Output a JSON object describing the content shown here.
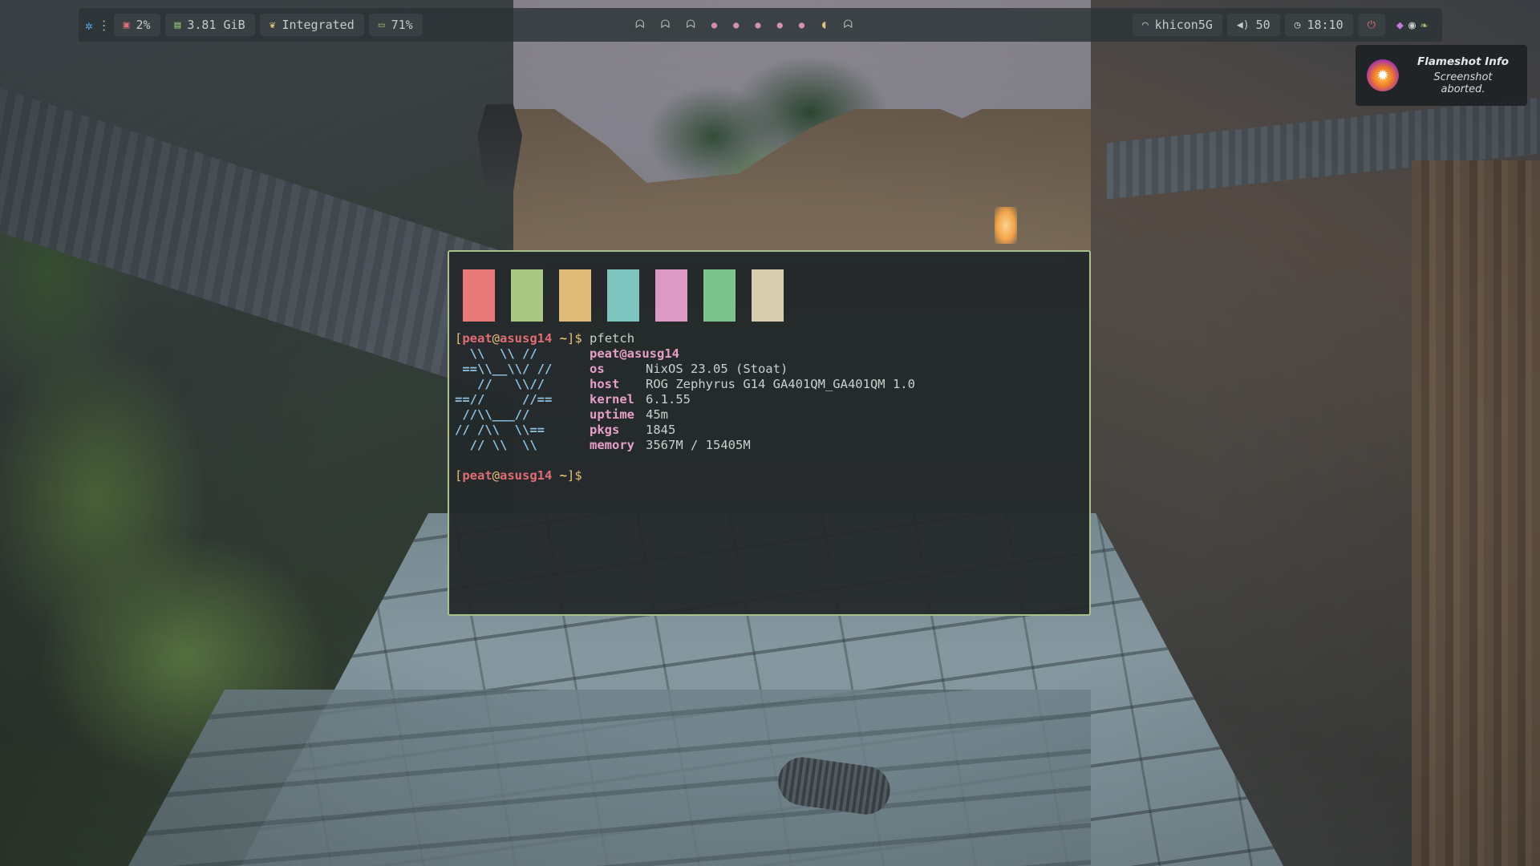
{
  "topbar": {
    "left": {
      "launcher_icon": "gear-icon",
      "menu_icon": "vertical-dots-icon",
      "cpu": {
        "icon": "cpu-chip-icon",
        "value": "2%"
      },
      "memory": {
        "icon": "ram-icon",
        "value": "3.81 GiB"
      },
      "gpu": {
        "icon": "leaf-icon",
        "value": "Integrated"
      },
      "battery": {
        "icon": "battery-icon",
        "value": "71%"
      }
    },
    "workspaces": [
      {
        "type": "ghost",
        "icon": "ghost-icon",
        "glyph": "ᗣ"
      },
      {
        "type": "ghost",
        "icon": "ghost-icon",
        "glyph": "ᗣ"
      },
      {
        "type": "ghost",
        "icon": "ghost-icon",
        "glyph": "ᗣ"
      },
      {
        "type": "dot",
        "icon": "dot-icon",
        "glyph": "●"
      },
      {
        "type": "dot",
        "icon": "dot-icon",
        "glyph": "●"
      },
      {
        "type": "dot",
        "icon": "dot-icon",
        "glyph": "●"
      },
      {
        "type": "dot",
        "icon": "dot-icon",
        "glyph": "●"
      },
      {
        "type": "dot",
        "icon": "dot-icon",
        "glyph": "●"
      },
      {
        "type": "pacman",
        "icon": "pacman-icon",
        "glyph": "◖"
      },
      {
        "type": "ghost",
        "icon": "ghost-icon",
        "glyph": "ᗣ"
      }
    ],
    "right": {
      "wifi": {
        "icon": "wifi-icon",
        "value": "khicon5G"
      },
      "volume": {
        "icon": "speaker-icon",
        "value": "50"
      },
      "clock": {
        "icon": "clock-icon",
        "value": "18:10"
      },
      "power_icon": "power-icon",
      "tray": [
        "flameshot-tray-icon",
        "discord-tray-icon",
        "leaf-tray-icon"
      ]
    }
  },
  "notification": {
    "icon": "flameshot-icon",
    "title": "Flameshot Info",
    "body": "Screenshot aborted."
  },
  "terminal": {
    "border_color": "#a7c08c",
    "swatch_colors": [
      "#e87a7a",
      "#a8c884",
      "#e0bb78",
      "#7ec4be",
      "#dc99c4",
      "#7dc48c",
      "#d8cdaf"
    ],
    "prompt": {
      "open": "[",
      "user": "peat",
      "at": "@",
      "host": "asusg14",
      "dir": " ~",
      "close": "]$"
    },
    "command": "pfetch",
    "logo_lines": [
      "  \\\\  \\\\ //",
      " ==\\\\__\\\\/ //",
      "   //   \\\\//",
      "==//     //==",
      " //\\\\___//",
      "// /\\\\  \\\\==",
      "  // \\\\  \\\\"
    ],
    "fetch_header": "peat@asusg14",
    "fetch": [
      {
        "key": "os",
        "value": "NixOS 23.05 (Stoat)"
      },
      {
        "key": "host",
        "value": "ROG Zephyrus G14 GA401QM_GA401QM 1.0"
      },
      {
        "key": "kernel",
        "value": "6.1.55"
      },
      {
        "key": "uptime",
        "value": "45m"
      },
      {
        "key": "pkgs",
        "value": "1845"
      },
      {
        "key": "memory",
        "value": "3567M / 15405M"
      }
    ]
  }
}
